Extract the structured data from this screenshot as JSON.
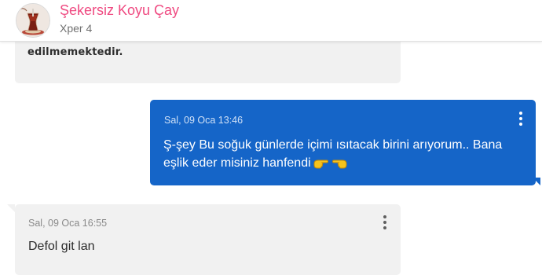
{
  "header": {
    "contact_name": "Şekersiz Koyu Çay",
    "contact_subtitle": "Xper 4",
    "avatar_icon": "tea-glass-avatar"
  },
  "messages": [
    {
      "direction": "received",
      "text": "edilmemektedir.",
      "partially_visible": true
    },
    {
      "direction": "sent",
      "timestamp": "Sal, 09 Oca 13:46",
      "text": "Ş-şey Bu soğuk günlerde içimi ısıtacak birini arıyorum.. Bana eşlik eder misiniz hanfendi",
      "emojis": [
        "backhand-index-pointing-right-icon",
        "backhand-index-pointing-left-icon"
      ],
      "menu_icon": "vertical-dots-icon"
    },
    {
      "direction": "received",
      "timestamp": "Sal, 09 Oca 16:55",
      "text": "Defol git lan",
      "menu_icon": "vertical-dots-icon"
    }
  ],
  "colors": {
    "accent": "#ef4a81",
    "sent_bubble": "#1565c8",
    "received_bubble": "#f1f1f1",
    "subtitle": "#707070"
  }
}
